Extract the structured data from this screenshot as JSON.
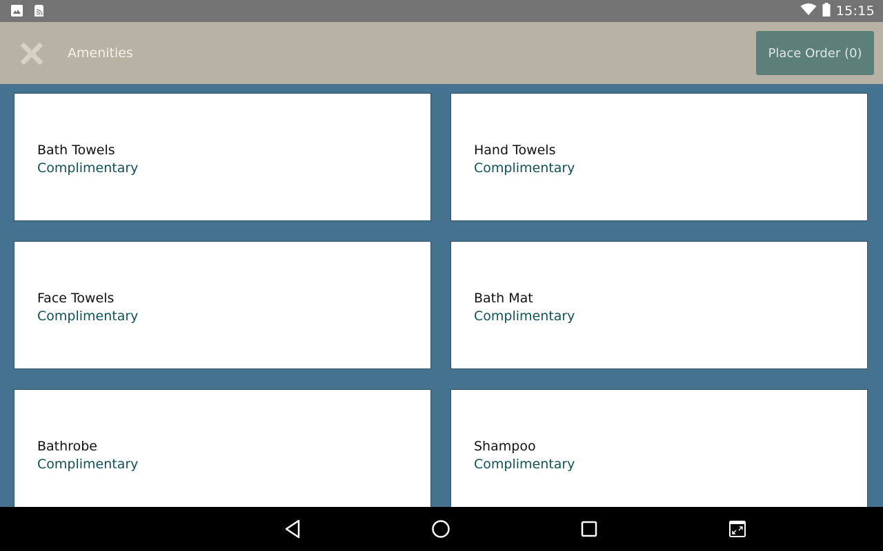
{
  "status_bar": {
    "left_icons": [
      "image-notification-icon",
      "nfc-payment-notification-icon"
    ],
    "right_icons": [
      "wifi-icon",
      "battery-icon"
    ],
    "time": "15:15"
  },
  "header": {
    "close_icon": "close-icon",
    "title": "Amenities",
    "place_order_label": "Place Order (0)",
    "background_color": "#b8b2a5",
    "button_color": "#5d7f79"
  },
  "content": {
    "background_color": "#44728f",
    "price_color": "#0f5257",
    "items": [
      {
        "name": "Bath Towels",
        "price": "Complimentary"
      },
      {
        "name": "Hand Towels",
        "price": "Complimentary"
      },
      {
        "name": "Face Towels",
        "price": "Complimentary"
      },
      {
        "name": "Bath Mat",
        "price": "Complimentary"
      },
      {
        "name": "Bathrobe",
        "price": "Complimentary"
      },
      {
        "name": "Shampoo",
        "price": "Complimentary"
      }
    ]
  },
  "nav_bar": {
    "buttons": [
      "back-icon",
      "home-icon",
      "recents-icon",
      "picture-in-picture-icon"
    ]
  }
}
